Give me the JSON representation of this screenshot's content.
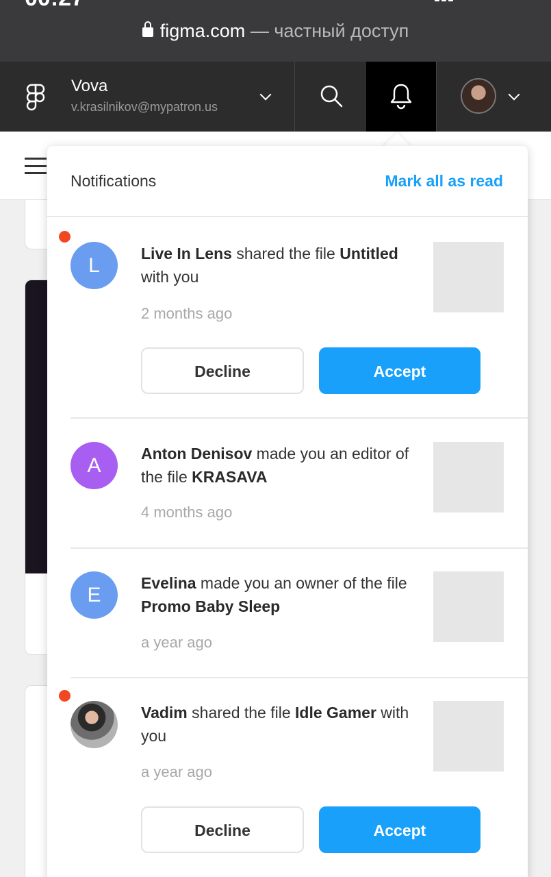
{
  "status": {
    "time": "00:27"
  },
  "browser": {
    "domain": "figma.com",
    "suffix": " — частный доступ"
  },
  "header": {
    "user_name": "Vova",
    "user_email": "v.krasilnikov@mypatron.us"
  },
  "notifications": {
    "title": "Notifications",
    "mark_all_label": "Mark all as read",
    "items": [
      {
        "unread": true,
        "avatar_letter": "L",
        "avatar_color": "#6a9cf0",
        "actor": "Live In Lens",
        "action": " shared the file ",
        "file": "Untitled",
        "after": " with you",
        "time": "2 months ago",
        "decline_label": "Decline",
        "accept_label": "Accept"
      },
      {
        "unread": false,
        "avatar_letter": "A",
        "avatar_color": "#a95ef2",
        "actor": "Anton Denisov",
        "action": " made you an editor of the file ",
        "file": "KRASAVA",
        "after": "",
        "time": "4 months ago"
      },
      {
        "unread": false,
        "avatar_letter": "E",
        "avatar_color": "#6a9cf0",
        "actor": "Evelina",
        "action": " made you an owner of the file ",
        "file": "Promo Baby Sleep",
        "after": "",
        "time": "a year ago"
      },
      {
        "unread": true,
        "avatar_letter": "",
        "actor": "Vadim",
        "action": " shared the file ",
        "file": "Idle Gamer",
        "after": " with you",
        "time": "a year ago",
        "decline_label": "Decline",
        "accept_label": "Accept"
      }
    ]
  }
}
